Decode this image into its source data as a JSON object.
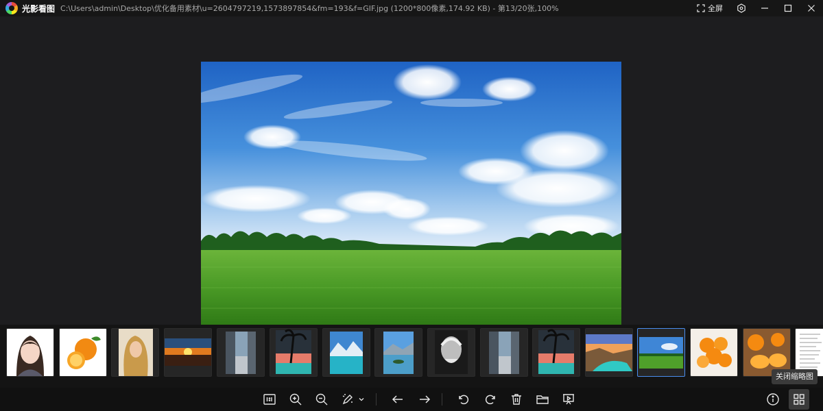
{
  "app": {
    "name": "光影看图",
    "file_info": "C:\\Users\\admin\\Desktop\\优化备用素材\\u=2604797219,1573897854&fm=193&f=GIF.jpg (1200*800像素,174.92 KB) - 第13/20张,100%"
  },
  "titlebar": {
    "fullscreen_label": "全屏",
    "icons": [
      "fullscreen-icon",
      "hexagon-settings-icon",
      "minimize-icon",
      "maximize-icon",
      "close-icon"
    ]
  },
  "thumbnails": {
    "selected_index": 12,
    "items": [
      "cartoon-girl",
      "orange",
      "blonde-woman",
      "sunset",
      "street",
      "palm-beach",
      "mountain-lake",
      "lake-island",
      "old-man-bw",
      "street",
      "palm-beach",
      "canyon-river",
      "sky-meadow",
      "oranges-bowl",
      "orange-halves",
      "document"
    ],
    "tooltip": "关闭缩略图"
  },
  "toolbar": {
    "actual_size_label": "1:1",
    "icons": [
      "actual-size-icon",
      "zoom-in-icon",
      "zoom-out-icon",
      "edit-icon",
      "dropdown-chevron-icon",
      "prev-arrow-icon",
      "next-arrow-icon",
      "rotate-left-icon",
      "rotate-right-icon",
      "delete-icon",
      "open-folder-icon",
      "slideshow-icon",
      "info-icon",
      "thumbnail-grid-icon"
    ]
  },
  "colors": {
    "background": "#1d1d1f",
    "titlebar": "#161616",
    "accent": "#4a8ef0"
  }
}
